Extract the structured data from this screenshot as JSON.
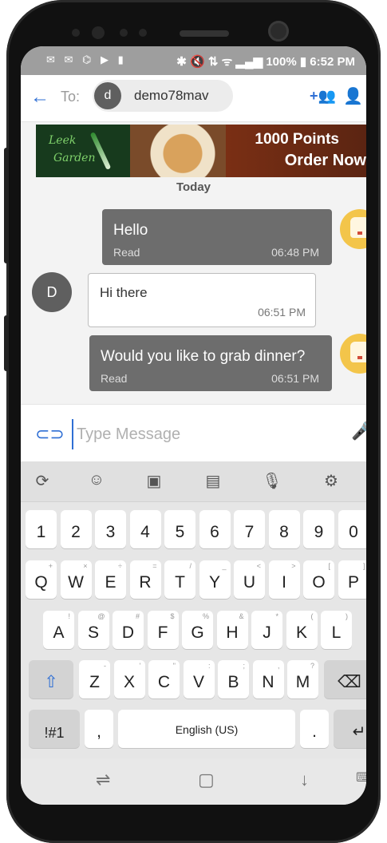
{
  "status_bar": {
    "left_icons": "✉ ✉ ⌬ ▶ ▮",
    "right_text": "✱ 🔇 ⇅ ᯤ ▂▄▆ 100% ▮ 6:52 PM"
  },
  "header": {
    "to_label": "To:",
    "recipient_initial": "d",
    "recipient_name": "demo78mav"
  },
  "ad": {
    "logo_line1": "Leek",
    "logo_line2": "Garden",
    "line1": "1000 Points",
    "line2": "Order Now"
  },
  "date_separator": "Today",
  "messages": [
    {
      "text": "Hello",
      "status": "Read",
      "time": "06:48 PM"
    },
    {
      "text": "Hi there",
      "time": "06:51 PM"
    },
    {
      "text": "Would you like to grab dinner?",
      "status": "Read",
      "time": "06:51 PM"
    }
  ],
  "contact_initial": "D",
  "compose": {
    "placeholder": "Type Message",
    "value": ""
  },
  "keyboard": {
    "number_row": [
      "1",
      "2",
      "3",
      "4",
      "5",
      "6",
      "7",
      "8",
      "9",
      "0"
    ],
    "row1": [
      {
        "k": "Q",
        "s": "+"
      },
      {
        "k": "W",
        "s": "×"
      },
      {
        "k": "E",
        "s": "÷"
      },
      {
        "k": "R",
        "s": "="
      },
      {
        "k": "T",
        "s": "/"
      },
      {
        "k": "Y",
        "s": "_"
      },
      {
        "k": "U",
        "s": "<"
      },
      {
        "k": "I",
        "s": ">"
      },
      {
        "k": "O",
        "s": "["
      },
      {
        "k": "P",
        "s": "]"
      }
    ],
    "row2": [
      {
        "k": "A",
        "s": "!"
      },
      {
        "k": "S",
        "s": "@"
      },
      {
        "k": "D",
        "s": "#"
      },
      {
        "k": "F",
        "s": "$"
      },
      {
        "k": "G",
        "s": "%"
      },
      {
        "k": "H",
        "s": "&"
      },
      {
        "k": "J",
        "s": "*"
      },
      {
        "k": "K",
        "s": "("
      },
      {
        "k": "L",
        "s": ")"
      }
    ],
    "row3": [
      {
        "k": "Z",
        "s": "-"
      },
      {
        "k": "X",
        "s": "'"
      },
      {
        "k": "C",
        "s": "\""
      },
      {
        "k": "V",
        "s": ":"
      },
      {
        "k": "B",
        "s": ";"
      },
      {
        "k": "N",
        "s": ","
      },
      {
        "k": "M",
        "s": "?"
      }
    ],
    "symbols_key": "!#1",
    "comma_key": ",",
    "space_label": "English (US)",
    "period_key": "."
  }
}
